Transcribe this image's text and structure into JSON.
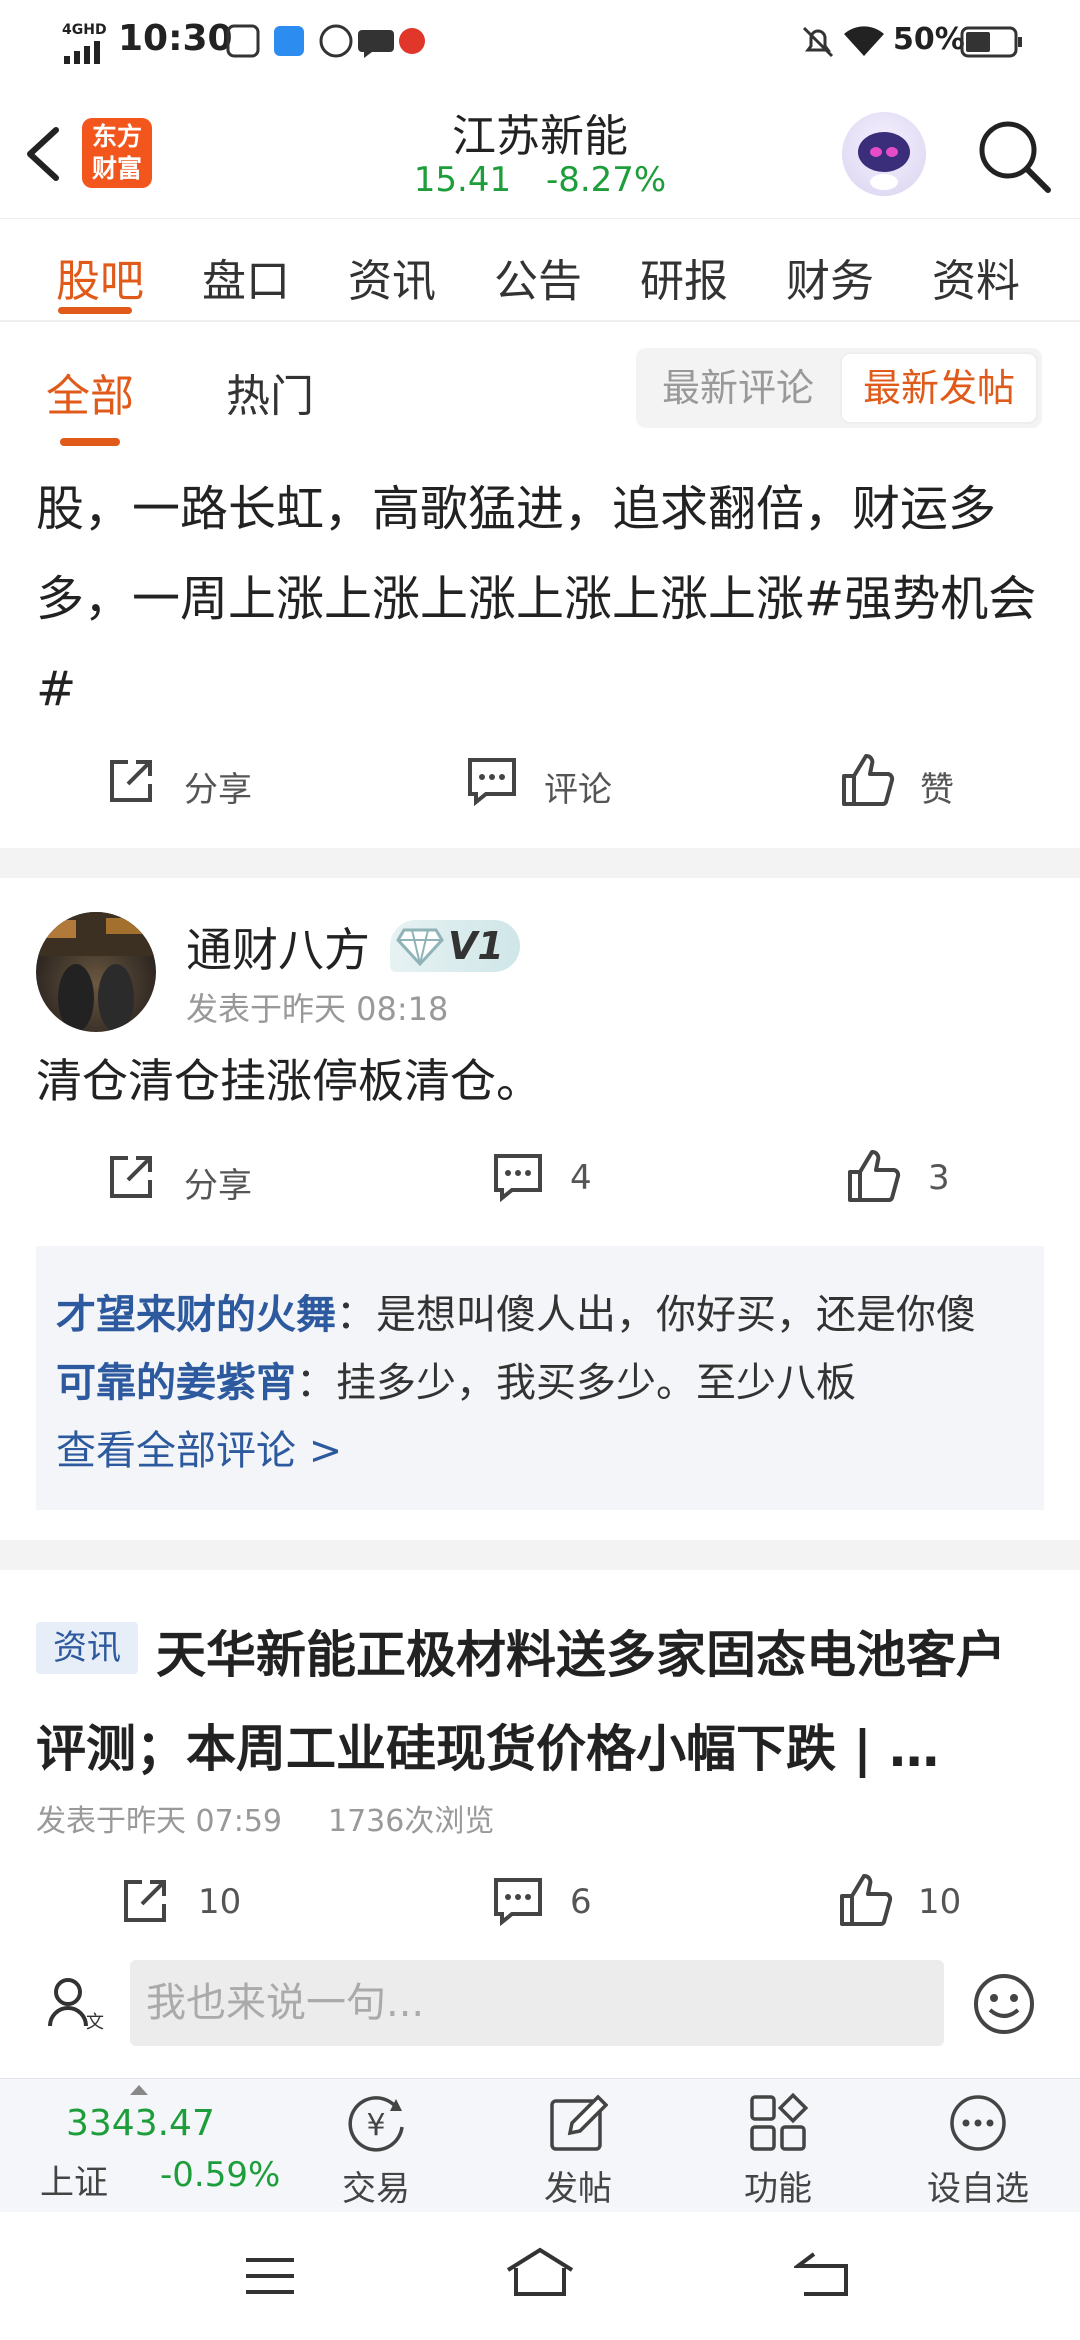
{
  "status_bar": {
    "network": "4GHD",
    "time": "10:30",
    "battery": "50%"
  },
  "header": {
    "logo_text": "东方财富",
    "logo_line1": "东方",
    "logo_line2": "财富",
    "stock_name": "江苏新能",
    "price": "15.41",
    "change_pct": "-8.27%"
  },
  "tabs": [
    "股吧",
    "盘口",
    "资讯",
    "公告",
    "研报",
    "财务",
    "资料"
  ],
  "filters": {
    "all": "全部",
    "hot": "热门",
    "latest_comment": "最新评论",
    "latest_post": "最新发帖"
  },
  "post1": {
    "text": "股，一路长虹，高歌猛进，追求翻倍，财运多多，一周上涨上涨上涨上涨上涨上涨#强势机会#",
    "share": "分享",
    "comment": "评论",
    "like": "赞"
  },
  "post2": {
    "author": "通财八方",
    "badge": "V1",
    "time": "发表于昨天 08:18",
    "text": "清仓清仓挂涨停板清仓。",
    "share": "分享",
    "comment_count": "4",
    "like_count": "3",
    "comments": [
      {
        "name": "才望来财的火舞",
        "text": "：是想叫傻人出，你好买，还是你傻"
      },
      {
        "name": "可靠的姜紫宵",
        "text": "：挂多少，我买多少。至少八板"
      }
    ],
    "view_all": "查看全部评论 >"
  },
  "post3": {
    "tag": "资讯",
    "title": "天华新能正极材料送多家固态电池客户评测；本周工业硅现货价格小幅下跌 | …",
    "time": "发表于昨天 07:59",
    "views": "1736次浏览",
    "share_count": "10",
    "comment_count": "6",
    "like_count": "10"
  },
  "input": {
    "placeholder": "我也来说一句..."
  },
  "bottom_nav": {
    "index_value": "3343.47",
    "index_name": "上证",
    "index_change": "-0.59%",
    "items": [
      "交易",
      "发帖",
      "功能",
      "设自选"
    ]
  },
  "colors": {
    "accent": "#e05a1a",
    "down_green": "#1e9e3a",
    "link_blue": "#2d5a9e"
  }
}
